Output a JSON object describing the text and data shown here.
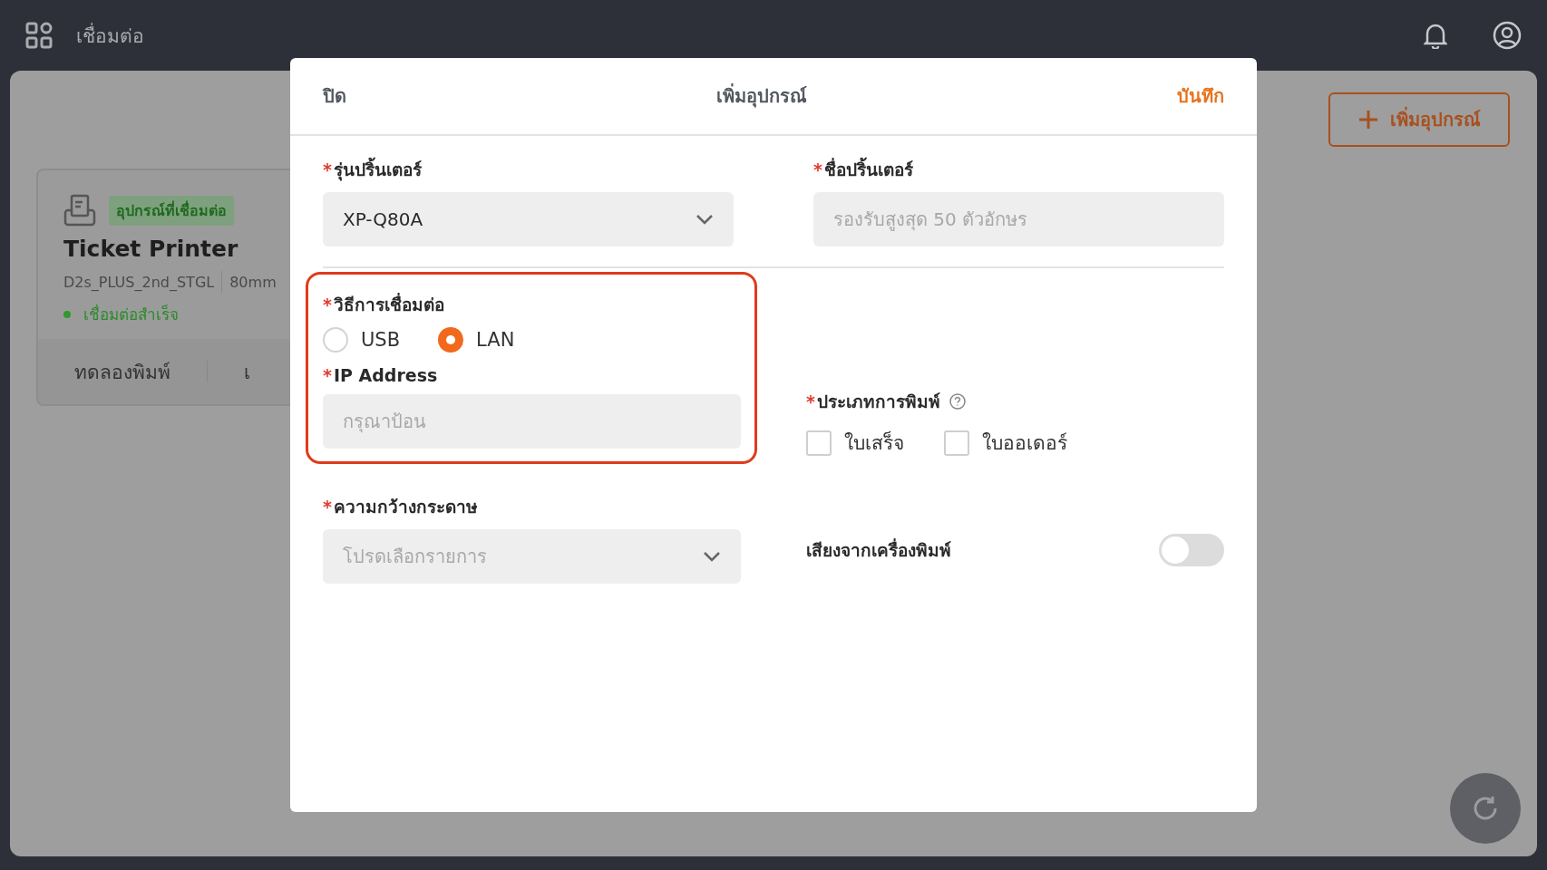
{
  "topbar": {
    "title": "เชื่อมต่อ"
  },
  "page": {
    "add_button": "เพิ่มอุปกรณ์"
  },
  "device_card": {
    "badge": "อุปกรณ์ที่เชื่อมต่อ",
    "name": "Ticket Printer",
    "model": "D2s_PLUS_2nd_STGL",
    "paper": "80mm",
    "status": "เชื่อมต่อสำเร็จ",
    "actions": [
      "ทดลองพิมพ์",
      "เ"
    ]
  },
  "dialog": {
    "close": "ปิด",
    "title": "เพิ่มอุปกรณ์",
    "save": "บันทึก",
    "printer_model": {
      "required_mark": "*",
      "label": "รุ่นปริ้นเตอร์",
      "value": "XP-Q80A"
    },
    "printer_name": {
      "required_mark": "*",
      "label": "ชื่อปริ้นเตอร์",
      "placeholder": "รองรับสูงสุด 50 ตัวอักษร"
    },
    "connection": {
      "required_mark": "*",
      "label": "วิธีการเชื่อมต่อ",
      "options": [
        {
          "label": "USB",
          "selected": false
        },
        {
          "label": "LAN",
          "selected": true
        }
      ]
    },
    "ip_address": {
      "required_mark": "*",
      "label": "IP Address",
      "placeholder": "กรุณาป้อน"
    },
    "print_type": {
      "required_mark": "*",
      "label": "ประเภทการพิมพ์",
      "options": [
        {
          "label": "ใบเสร็จ",
          "checked": false
        },
        {
          "label": "ใบออเดอร์",
          "checked": false
        }
      ]
    },
    "paper_width": {
      "required_mark": "*",
      "label": "ความกว้างกระดาษ",
      "placeholder": "โปรดเลือกรายการ"
    },
    "printer_sound": {
      "label": "เสียงจากเครื่องพิมพ์",
      "on": false
    }
  }
}
